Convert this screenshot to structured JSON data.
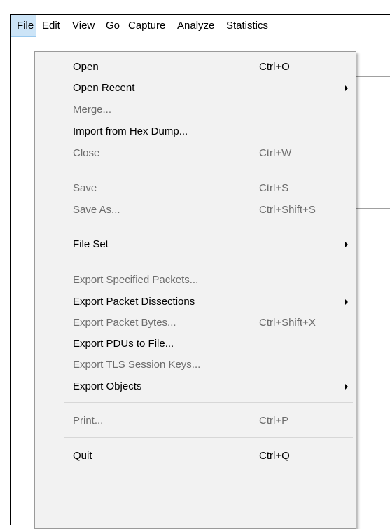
{
  "menubar": {
    "items": [
      {
        "label": "File",
        "active": true
      },
      {
        "label": "Edit"
      },
      {
        "label": "View"
      },
      {
        "label": "Go"
      },
      {
        "label": "Capture"
      },
      {
        "label": "Analyze"
      },
      {
        "label": "Statistics"
      }
    ]
  },
  "file_menu": {
    "items": [
      {
        "label": "Open",
        "shortcut": "Ctrl+O",
        "enabled": true
      },
      {
        "label": "Open Recent",
        "shortcut": "",
        "enabled": true,
        "submenu": true
      },
      {
        "label": "Merge...",
        "shortcut": "",
        "enabled": false
      },
      {
        "label": "Import from Hex Dump...",
        "shortcut": "",
        "enabled": true
      },
      {
        "label": "Close",
        "shortcut": "Ctrl+W",
        "enabled": false
      },
      {
        "label": "Save",
        "shortcut": "Ctrl+S",
        "enabled": false
      },
      {
        "label": "Save As...",
        "shortcut": "Ctrl+Shift+S",
        "enabled": false
      },
      {
        "label": "File Set",
        "shortcut": "",
        "enabled": true,
        "submenu": true
      },
      {
        "label": "Export Specified Packets...",
        "shortcut": "",
        "enabled": false
      },
      {
        "label": "Export Packet Dissections",
        "shortcut": "",
        "enabled": true,
        "submenu": true
      },
      {
        "label": "Export Packet Bytes...",
        "shortcut": "Ctrl+Shift+X",
        "enabled": false
      },
      {
        "label": "Export PDUs to File...",
        "shortcut": "",
        "enabled": true
      },
      {
        "label": "Export TLS Session Keys...",
        "shortcut": "",
        "enabled": false
      },
      {
        "label": "Export Objects",
        "shortcut": "",
        "enabled": true,
        "submenu": true
      },
      {
        "label": "Print...",
        "shortcut": "Ctrl+P",
        "enabled": false
      },
      {
        "label": "Quit",
        "shortcut": "Ctrl+Q",
        "enabled": true
      }
    ]
  },
  "icons": [
    "submenu-arrow-icon",
    "go-first-packet-icon",
    "go-last-packet-icon"
  ],
  "colors": {
    "menu_bg": "#f2f2f2",
    "active_menu_bg": "#cce4f7",
    "active_menu_border": "#99c9ef",
    "disabled_text": "#6d6d6d"
  }
}
